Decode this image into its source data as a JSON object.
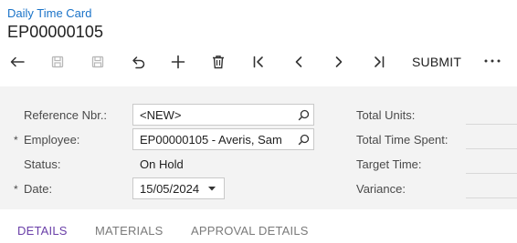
{
  "header": {
    "breadcrumb": "Daily Time Card",
    "title": "EP00000105"
  },
  "toolbar": {
    "submit_label": "SUBMIT",
    "more_label": "⋯",
    "icons": [
      "back-icon",
      "copy-icon",
      "save-icon",
      "undo-icon",
      "add-icon",
      "delete-icon",
      "first-record-icon",
      "previous-record-icon",
      "next-record-icon",
      "last-record-icon"
    ]
  },
  "form": {
    "reference_nbr": {
      "label": "Reference Nbr.:",
      "value": "<NEW>"
    },
    "employee": {
      "label": "Employee:",
      "required_mark": "*",
      "value": "EP00000105 - Averis, Sam"
    },
    "status": {
      "label": "Status:",
      "value": "On Hold"
    },
    "date": {
      "label": "Date:",
      "required_mark": "*",
      "value": "15/05/2024"
    },
    "summary": {
      "total_units_label": "Total Units:",
      "total_time_spent_label": "Total Time Spent:",
      "target_time_label": "Target Time:",
      "variance_label": "Variance:"
    }
  },
  "tabs": [
    {
      "label": "DETAILS",
      "active": true
    },
    {
      "label": "MATERIALS",
      "active": false
    },
    {
      "label": "APPROVAL DETAILS",
      "active": false
    }
  ],
  "colors": {
    "link": "#1a73c8",
    "active_tab": "#6a3fa8",
    "panel_bg": "#f3f3f3"
  }
}
